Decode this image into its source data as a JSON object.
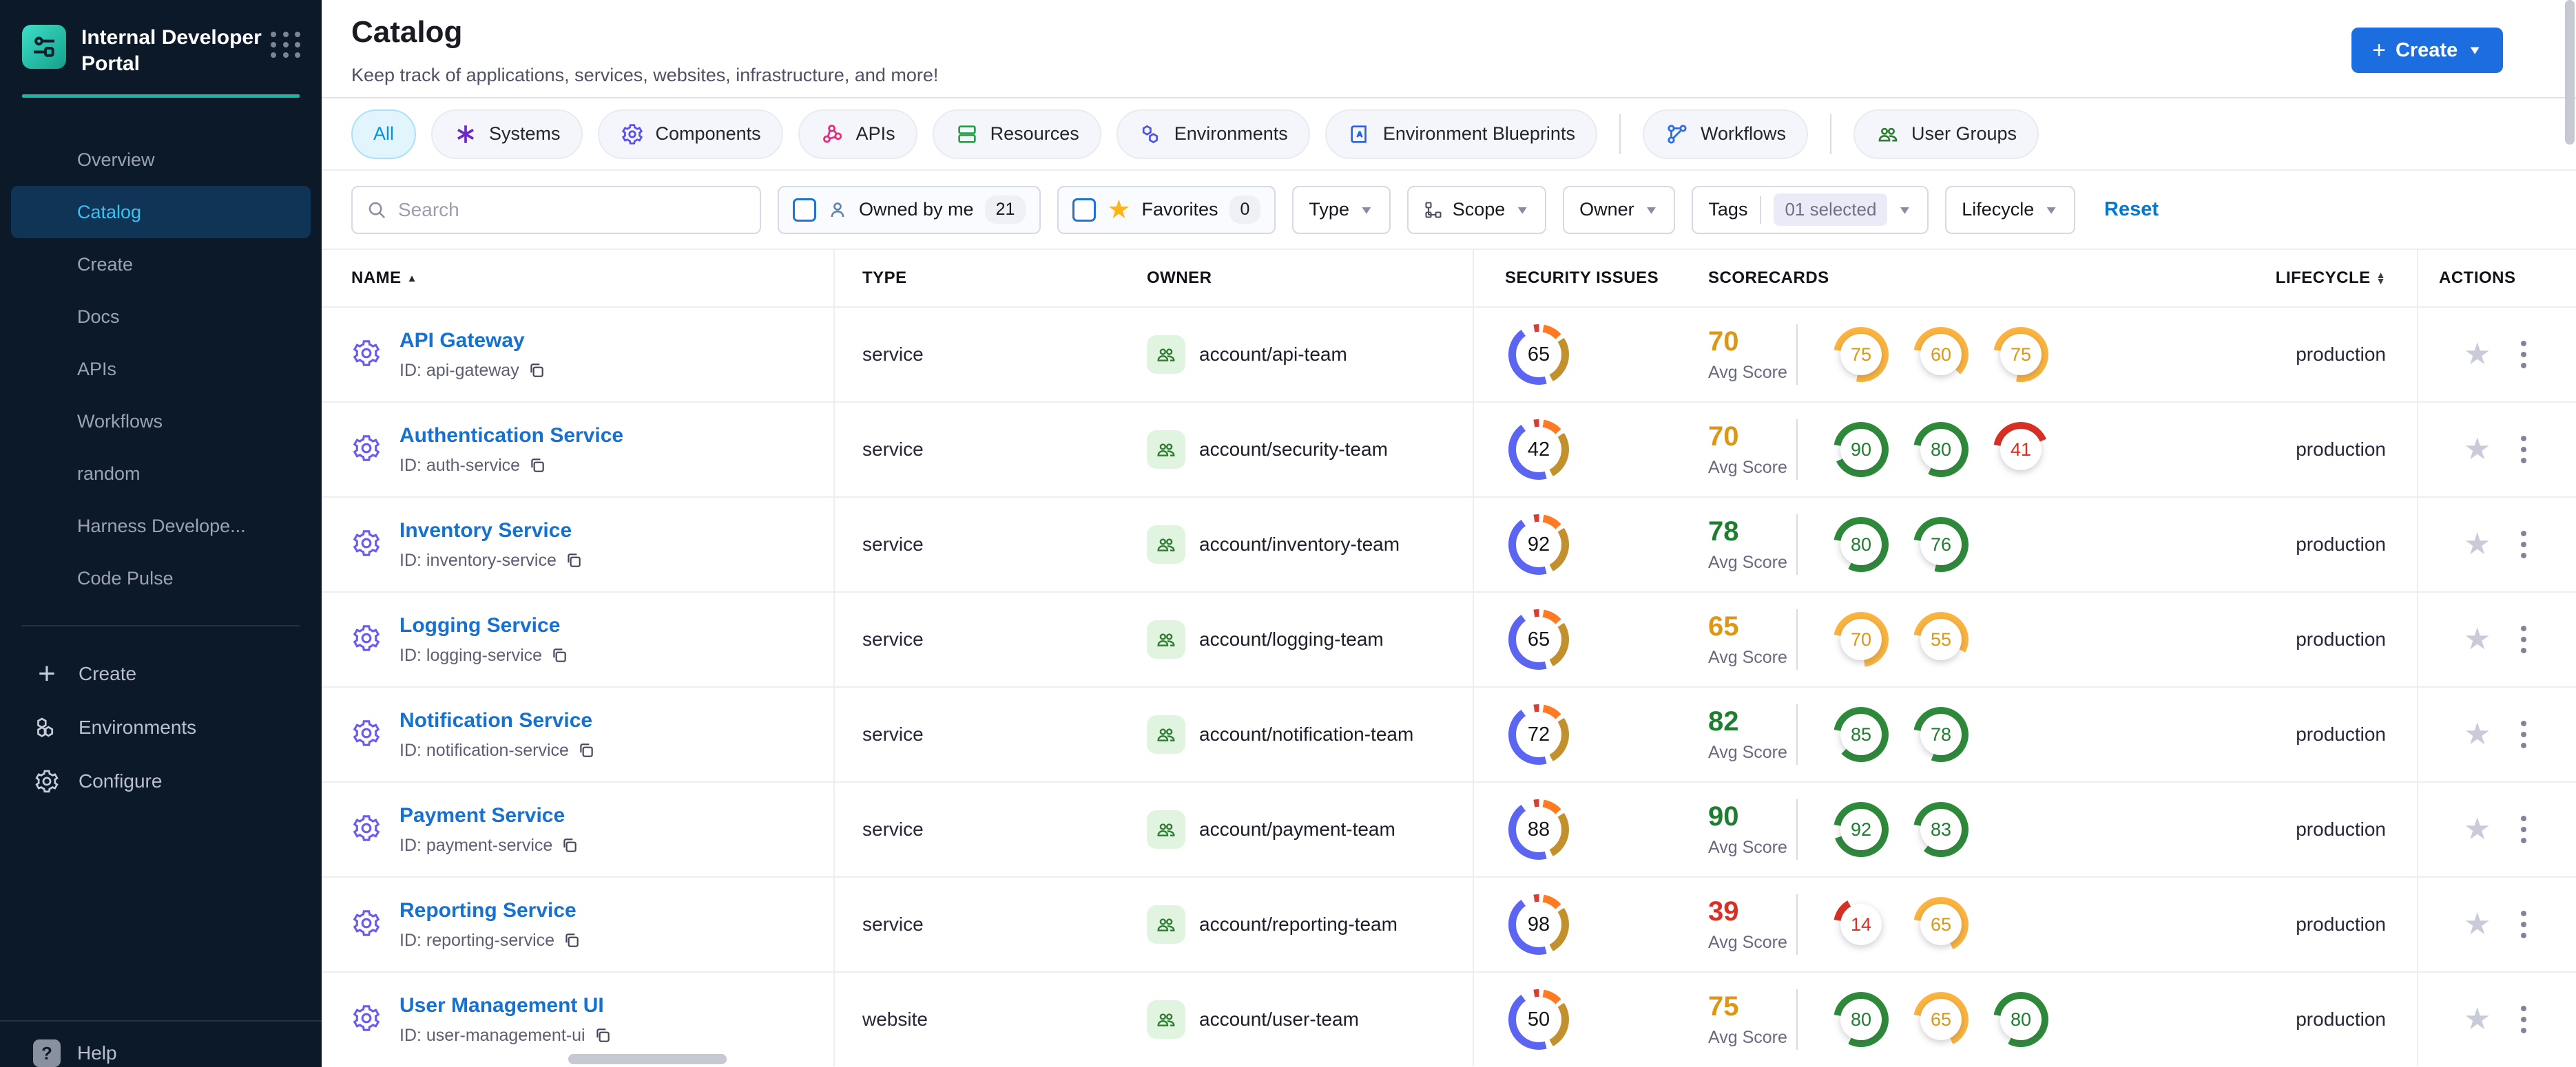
{
  "app": {
    "brand": "Internal Developer Portal"
  },
  "palette": {
    "accent_teal": "#17b7a0",
    "primary_blue": "#1b6de0",
    "link_blue": "#1672d2",
    "tones": {
      "green": {
        "arc": "#2e8b3a",
        "text": "#1e7d2f"
      },
      "amber": {
        "arc": "#fbb43f",
        "text": "#dd9712"
      },
      "red": {
        "arc": "#d93025",
        "text": "#d93025"
      }
    },
    "security_segments": {
      "blue": "#5b65f1",
      "red": "#e03a2e",
      "orange": "#ff7a22",
      "gold": "#c2912e"
    }
  },
  "sidebar": {
    "items": [
      {
        "label": "Overview",
        "active": false
      },
      {
        "label": "Catalog",
        "active": true
      },
      {
        "label": "Create",
        "active": false
      },
      {
        "label": "Docs",
        "active": false
      },
      {
        "label": "APIs",
        "active": false
      },
      {
        "label": "Workflows",
        "active": false
      },
      {
        "label": "random",
        "active": false
      },
      {
        "label": "Harness Develope...",
        "active": false
      },
      {
        "label": "Code Pulse",
        "active": false
      }
    ],
    "bottom_items": [
      {
        "label": "Create",
        "icon": "plus-icon"
      },
      {
        "label": "Environments",
        "icon": "hexagon-icon"
      },
      {
        "label": "Configure",
        "icon": "gear-icon"
      }
    ],
    "footer_item": {
      "label": "Help",
      "icon": "help-icon"
    }
  },
  "header": {
    "title": "Catalog",
    "subtitle": "Keep track of applications, services, websites, infrastructure, and more!",
    "create_button": "Create"
  },
  "tabs": [
    {
      "label": "All",
      "active": true,
      "icon": "",
      "icon_color": ""
    },
    {
      "label": "Systems",
      "active": false,
      "icon": "systems",
      "icon_color": "#6d28c9",
      "divider_before": false
    },
    {
      "label": "Components",
      "active": false,
      "icon": "components",
      "icon_color": "#554ff0",
      "divider_before": false
    },
    {
      "label": "APIs",
      "active": false,
      "icon": "apis",
      "icon_color": "#e0317c",
      "divider_before": false
    },
    {
      "label": "Resources",
      "active": false,
      "icon": "resources",
      "icon_color": "#23a047",
      "divider_before": false
    },
    {
      "label": "Environments",
      "active": false,
      "icon": "environments",
      "icon_color": "#4d53e8",
      "divider_before": false
    },
    {
      "label": "Environment Blueprints",
      "active": false,
      "icon": "blueprints",
      "icon_color": "#2563eb",
      "divider_before": false
    },
    {
      "label": "Workflows",
      "active": false,
      "icon": "workflows",
      "icon_color": "#2c6ee8",
      "divider_before": true
    },
    {
      "label": "User Groups",
      "active": false,
      "icon": "usergroups",
      "icon_color": "#2e7d32",
      "divider_before": true
    }
  ],
  "filters": {
    "search_placeholder": "Search",
    "owned_by_me": {
      "label": "Owned by me",
      "count": "21"
    },
    "favorites": {
      "label": "Favorites",
      "count": "0"
    },
    "type_dd": "Type",
    "scope_dd": "Scope",
    "owner_dd": "Owner",
    "tags_dd": {
      "label": "Tags",
      "value": "01 selected"
    },
    "lifecycle_dd": "Lifecycle",
    "reset": "Reset"
  },
  "table": {
    "columns": [
      "NAME",
      "TYPE",
      "OWNER",
      "SECURITY ISSUES",
      "SCORECARDS",
      "LIFECYCLE",
      "ACTIONS"
    ],
    "avg_label": "Avg Score",
    "rows": [
      {
        "name": "API Gateway",
        "id": "ID: api-gateway",
        "type": "service",
        "owner": "account/api-team",
        "security": "65",
        "avg": "70",
        "avg_tone": "amber",
        "lifecycle": "production",
        "rings": [
          {
            "value": "75",
            "tone": "amber"
          },
          {
            "value": "60",
            "tone": "amber"
          },
          {
            "value": "75",
            "tone": "amber"
          }
        ]
      },
      {
        "name": "Authentication Service",
        "id": "ID: auth-service",
        "type": "service",
        "owner": "account/security-team",
        "security": "42",
        "avg": "70",
        "avg_tone": "amber",
        "lifecycle": "production",
        "rings": [
          {
            "value": "90",
            "tone": "green"
          },
          {
            "value": "80",
            "tone": "green"
          },
          {
            "value": "41",
            "tone": "red"
          }
        ]
      },
      {
        "name": "Inventory Service",
        "id": "ID: inventory-service",
        "type": "service",
        "owner": "account/inventory-team",
        "security": "92",
        "avg": "78",
        "avg_tone": "green",
        "lifecycle": "production",
        "rings": [
          {
            "value": "80",
            "tone": "green"
          },
          {
            "value": "76",
            "tone": "green"
          }
        ]
      },
      {
        "name": "Logging Service",
        "id": "ID: logging-service",
        "type": "service",
        "owner": "account/logging-team",
        "security": "65",
        "avg": "65",
        "avg_tone": "amber",
        "lifecycle": "production",
        "rings": [
          {
            "value": "70",
            "tone": "amber"
          },
          {
            "value": "55",
            "tone": "amber"
          }
        ]
      },
      {
        "name": "Notification Service",
        "id": "ID: notification-service",
        "type": "service",
        "owner": "account/notification-team",
        "security": "72",
        "avg": "82",
        "avg_tone": "green",
        "lifecycle": "production",
        "rings": [
          {
            "value": "85",
            "tone": "green"
          },
          {
            "value": "78",
            "tone": "green"
          }
        ]
      },
      {
        "name": "Payment Service",
        "id": "ID: payment-service",
        "type": "service",
        "owner": "account/payment-team",
        "security": "88",
        "avg": "90",
        "avg_tone": "green",
        "lifecycle": "production",
        "rings": [
          {
            "value": "92",
            "tone": "green"
          },
          {
            "value": "83",
            "tone": "green"
          }
        ]
      },
      {
        "name": "Reporting Service",
        "id": "ID: reporting-service",
        "type": "service",
        "owner": "account/reporting-team",
        "security": "98",
        "avg": "39",
        "avg_tone": "red",
        "lifecycle": "production",
        "rings": [
          {
            "value": "14",
            "tone": "red"
          },
          {
            "value": "65",
            "tone": "amber"
          }
        ]
      },
      {
        "name": "User Management UI",
        "id": "ID: user-management-ui",
        "type": "website",
        "owner": "account/user-team",
        "security": "50",
        "avg": "75",
        "avg_tone": "amber",
        "lifecycle": "production",
        "rings": [
          {
            "value": "80",
            "tone": "green"
          },
          {
            "value": "65",
            "tone": "amber"
          },
          {
            "value": "80",
            "tone": "green"
          }
        ]
      }
    ]
  }
}
